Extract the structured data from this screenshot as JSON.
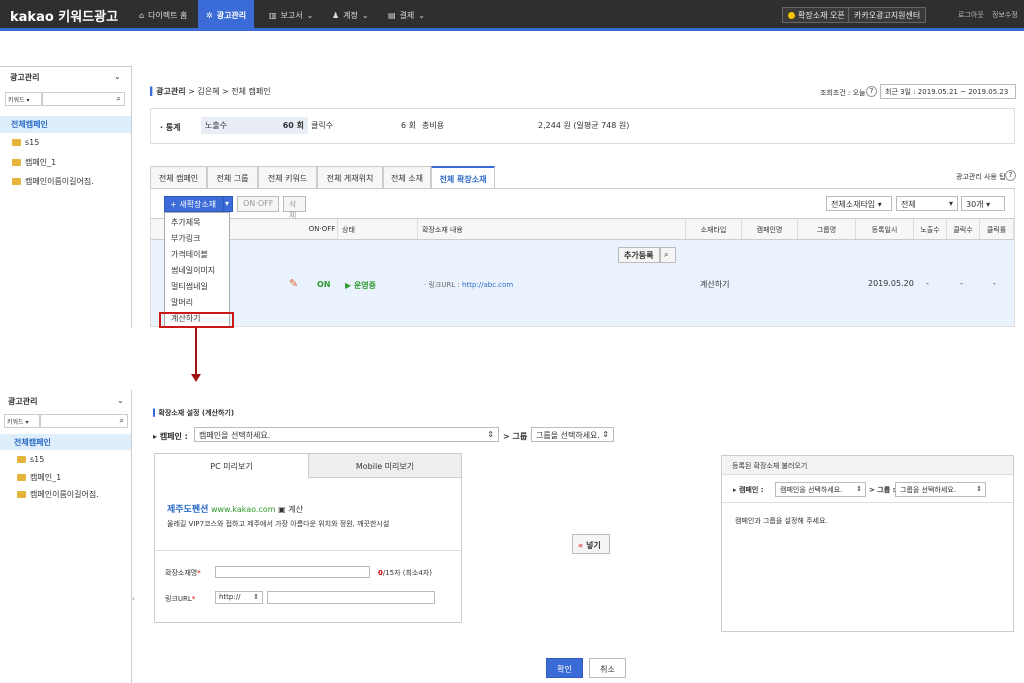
{
  "topbar": {
    "logo": "kakao 키워드광고",
    "nav": [
      {
        "label": "다이렉트 홈",
        "icon": "home-icon"
      },
      {
        "label": "광고관리",
        "icon": "gear-icon"
      },
      {
        "label": "보고서",
        "icon": "chart-icon"
      },
      {
        "label": "계정",
        "icon": "user-icon"
      },
      {
        "label": "결제",
        "icon": "card-icon"
      }
    ],
    "promo_btn": "확장소재 오픈",
    "support_btn": "카카오광고지원센터",
    "logout": "로그아웃",
    "info": "정보수정"
  },
  "sidebar": {
    "title": "광고관리",
    "filter": "키워드",
    "all_campaign": "전체캠페인",
    "items": [
      "s15",
      "캠페인_1",
      "캠페인이름이길어짐."
    ]
  },
  "main": {
    "breadcrumb": [
      "광고관리",
      "김은혜",
      "전체 캠페인"
    ],
    "period_label": "조회조건 : 오늘",
    "period_value": "최근 3일 : 2019.05.21 ~ 2019.05.23",
    "stats_label": "· 통계",
    "stats": [
      {
        "label": "노출수",
        "value": "60 회"
      },
      {
        "label": "클릭수",
        "value": "6 회"
      },
      {
        "label": "총비용",
        "value": "2,244 원 (일평균 748 원)"
      }
    ],
    "tabs": [
      "전체 캠페인",
      "전체 그룹",
      "전체 키워드",
      "전체 게재위치",
      "전체 소재",
      "전체 확장소재"
    ],
    "tip": "광고관리 사용 팁",
    "new_btn": "+ 새확장소재",
    "onoff_btn": "ON·OFF",
    "delete_btn": "삭제",
    "filter_type": "전체소재타입",
    "filter_all": "전체",
    "page_size": "30개",
    "columns": [
      "ON·OFF",
      "상태",
      "확장소재 내용",
      "소재타입",
      "캠페인명",
      "그룹명",
      "등록일시",
      "노출수",
      "클릭수",
      "클릭률"
    ],
    "dropdown": [
      "추가제목",
      "부가링크",
      "가격테이블",
      "썸네일이미지",
      "멀티썸네일",
      "말머리",
      "계산하기"
    ],
    "row": {
      "onoff": "ON",
      "status": "▶ 운영중",
      "add_btn": "추가등록",
      "link_prefix": "· 링크URL :",
      "link": "http://abc.com",
      "type": "계산하기",
      "date": "2019.05.20",
      "imp": "-",
      "click": "-",
      "ctr": "-"
    }
  },
  "form": {
    "title": "확장소재 설정 (계산하기)",
    "campaign_label": "캠페인 :",
    "campaign_placeholder": "캠페인을 선택하세요.",
    "group_label": "> 그룹 :",
    "group_placeholder": "그룹을 선택하세요.",
    "pc_tab": "PC 미리보기",
    "mobile_tab": "Mobile 미리보기",
    "preview_title": "제주도펜션",
    "preview_url": "www.kakao.com",
    "preview_ext": "계산",
    "preview_desc": "올레길 VIP7코스와 접하고 제주에서 가장 아름다운 위치와 정원, 깨끗한시설",
    "name_label": "확장소재명",
    "counter_cur": "0",
    "counter_rest": "/15자 (최소4자)",
    "link_label": "링크URL",
    "protocol": "http://",
    "move_btn": "넣기",
    "right_title": "등록된 확장소재 불러오기",
    "right_campaign_label": "캠페인 :",
    "right_campaign": "캠페인을 선택하세요.",
    "right_group_label": "> 그룹 :",
    "right_group": "그룹을 선택하세요.",
    "right_msg": "캠페인과 그룹을 설정해 주세요.",
    "confirm": "확인",
    "cancel": "취소"
  }
}
